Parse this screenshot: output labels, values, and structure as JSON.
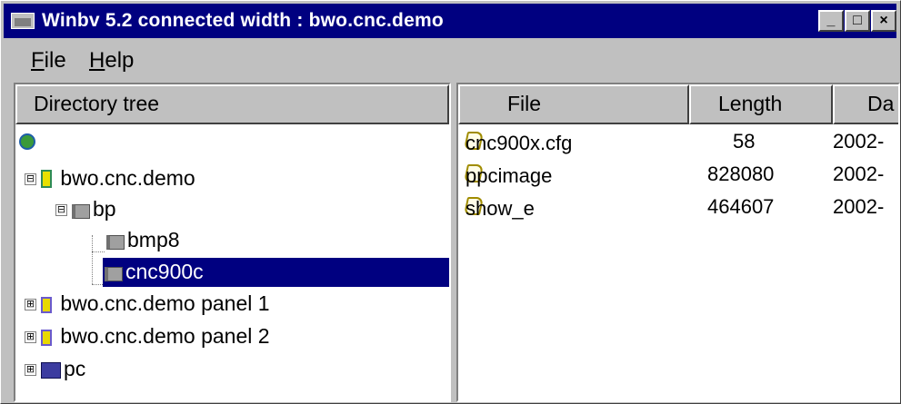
{
  "window": {
    "title": "Winbv 5.2 connected width : bwo.cnc.demo",
    "minimize": "_",
    "maximize": "□",
    "close": "×"
  },
  "menu": [
    {
      "label_ul": "F",
      "label_rest": "ile"
    },
    {
      "label_ul": "H",
      "label_rest": "elp"
    }
  ],
  "tree": {
    "header": "Directory tree",
    "nodes": [
      {
        "label": "bwo.cnc.demo",
        "icon": "server-icon",
        "expander": "⊟"
      },
      {
        "label": "bp",
        "icon": "folder-icon",
        "expander": "⊟"
      },
      {
        "label": "bmp8",
        "icon": "folder-icon"
      },
      {
        "label": "cnc900c",
        "icon": "folder-icon",
        "selected": true
      },
      {
        "label": "bwo.cnc.demo panel 1",
        "icon": "panel-icon",
        "expander": "⊞"
      },
      {
        "label": "bwo.cnc.demo panel 2",
        "icon": "panel-icon",
        "expander": "⊞"
      },
      {
        "label": "pc",
        "icon": "computer-icon",
        "expander": "⊞"
      }
    ]
  },
  "files": {
    "columns": [
      "File",
      "Length",
      "Da"
    ],
    "rows": [
      {
        "name": "cnc900x.cfg",
        "length": "58",
        "date": "2002-"
      },
      {
        "name": "ppcimage",
        "length": "828080",
        "date": "2002-"
      },
      {
        "name": "show_e",
        "length": "464607",
        "date": "2002-"
      }
    ]
  },
  "colors": {
    "titlebar": "#000080",
    "selection": "#000080",
    "face": "#c0c0c0"
  }
}
